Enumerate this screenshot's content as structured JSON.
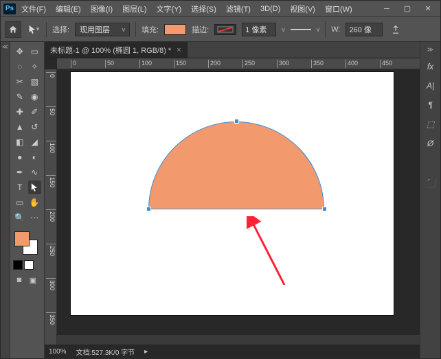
{
  "menubar": {
    "items": [
      "文件(F)",
      "编辑(E)",
      "图像(I)",
      "图层(L)",
      "文字(Y)",
      "选择(S)",
      "滤镜(T)",
      "3D(D)",
      "视图(V)",
      "窗口(W)"
    ]
  },
  "options": {
    "select_label": "选择:",
    "select_value": "现用图层",
    "fill_label": "填充:",
    "stroke_label": "描边:",
    "stroke_width": "1 像素",
    "w_label": "W:",
    "w_value": "260 像"
  },
  "tab": {
    "title": "未标题-1 @ 100% (椭圆 1, RGB/8) *"
  },
  "rulers": {
    "h": [
      "0",
      "50",
      "100",
      "150",
      "200",
      "250",
      "300",
      "350",
      "400",
      "450"
    ],
    "v": [
      "0",
      "50",
      "100",
      "150",
      "200",
      "250",
      "300",
      "350"
    ]
  },
  "status": {
    "zoom": "100%",
    "info": "文档:527.3K/0 字节"
  },
  "right_icons": [
    "fx",
    "A|",
    "¶",
    "⬚",
    "Ø",
    "⬛"
  ],
  "colors": {
    "fill": "#f2996e",
    "bg": "#ffffff"
  }
}
